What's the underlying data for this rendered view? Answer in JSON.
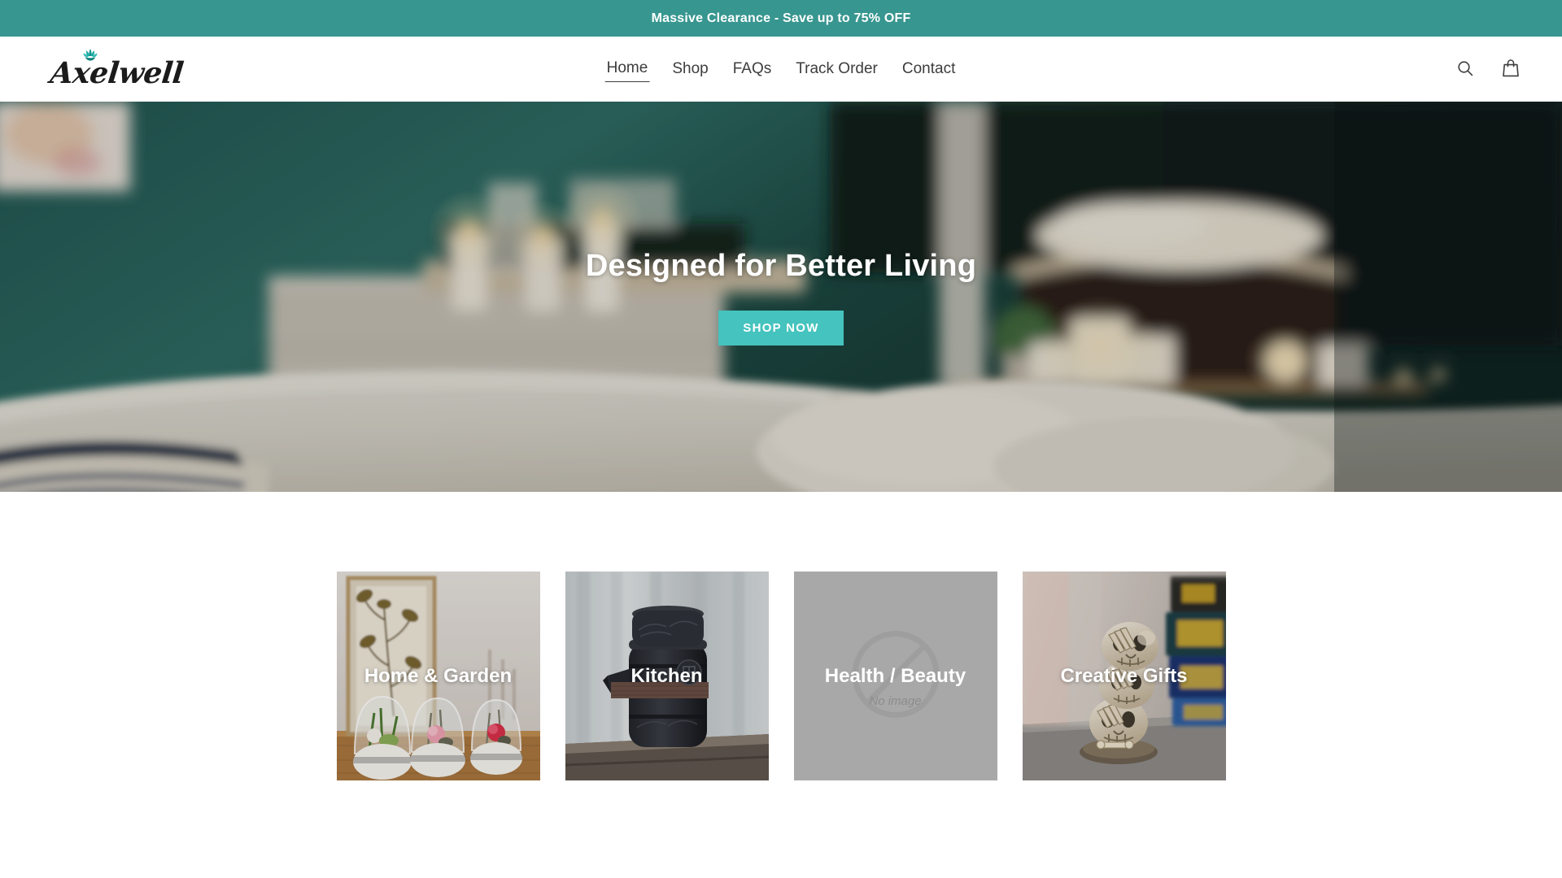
{
  "announcement": {
    "text": "Massive Clearance - Save up to 75% OFF",
    "background_color": "#389690",
    "text_color": "#ffffff"
  },
  "header": {
    "logo": {
      "wordmark": "Axelwell",
      "icon": "lotus-flower-icon",
      "icon_color": "#1aa7a0"
    },
    "nav": [
      {
        "label": "Home",
        "active": true
      },
      {
        "label": "Shop",
        "active": false
      },
      {
        "label": "FAQs",
        "active": false
      },
      {
        "label": "Track Order",
        "active": false
      },
      {
        "label": "Contact",
        "active": false
      }
    ],
    "actions": [
      {
        "name": "search-icon",
        "label": "Search"
      },
      {
        "name": "cart-icon",
        "label": "Cart"
      }
    ]
  },
  "hero": {
    "title": "Designed for Better Living",
    "cta_label": "SHOP NOW",
    "cta_color": "#45c3be",
    "scene": "blurred bedroom with teal wall, white bedding, blue striped throw, lit candles on dresser and shelf with towels and basket"
  },
  "categories": {
    "items": [
      {
        "label": "Home & Garden",
        "has_image": true,
        "scene": "glass dome cloche diffusers with preserved flowers on wooden table"
      },
      {
        "label": "Kitchen",
        "has_image": true,
        "scene": "black textured ceramic travel teapot on weathered wood"
      },
      {
        "label": "Health / Beauty",
        "has_image": false,
        "placeholder_text": "No image",
        "placeholder_color": "#a8a8a8"
      },
      {
        "label": "Creative Gifts",
        "has_image": true,
        "scene": "stacked three-skull resin figurine beside colorful books"
      }
    ]
  }
}
